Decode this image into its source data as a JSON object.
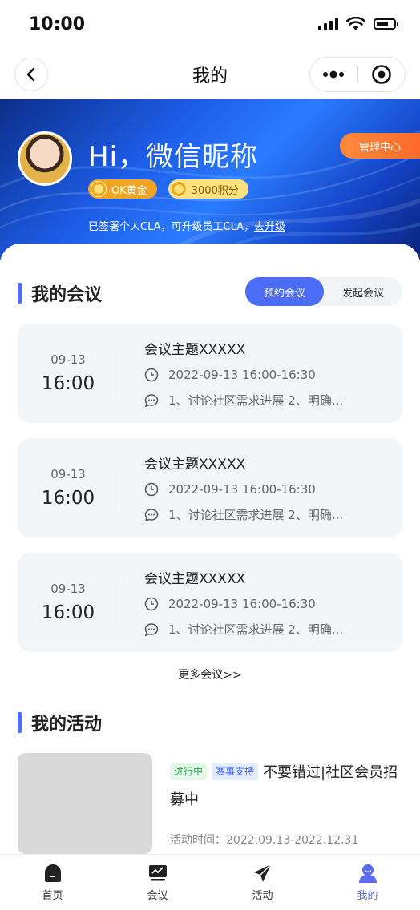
{
  "status_bar": {
    "time": "10:00"
  },
  "nav": {
    "title": "我的"
  },
  "profile": {
    "greeting": "Hi，微信昵称",
    "level_badge": "OK黄金",
    "points_badge": "3000积分",
    "cla_text": "已签署个人CLA，可升级员工CLA，",
    "cla_link": "去升级",
    "manage_button": "管理中心"
  },
  "meetings": {
    "section_title": "我的会议",
    "tabs": [
      {
        "label": "预约会议",
        "active": true
      },
      {
        "label": "发起会议",
        "active": false
      }
    ],
    "items": [
      {
        "date": "09-13",
        "time": "16:00",
        "title": "会议主题XXXXX",
        "datetime": "2022-09-13  16:00-16:30",
        "agenda": "1、讨论社区需求进展 2、明确..."
      },
      {
        "date": "09-13",
        "time": "16:00",
        "title": "会议主题XXXXX",
        "datetime": "2022-09-13  16:00-16:30",
        "agenda": "1、讨论社区需求进展 2、明确..."
      },
      {
        "date": "09-13",
        "time": "16:00",
        "title": "会议主题XXXXX",
        "datetime": "2022-09-13  16:00-16:30",
        "agenda": "1、讨论社区需求进展 2、明确..."
      }
    ],
    "more_link": "更多会议>>"
  },
  "activities": {
    "section_title": "我的活动",
    "items": [
      {
        "status_tag": "进行中",
        "type_tag": "赛事支持",
        "title": "不要错过|社区会员招募中",
        "time": "活动时间：2022.09.13-2022.12.31"
      }
    ]
  },
  "tab_bar": {
    "items": [
      {
        "label": "首页",
        "icon": "home-icon"
      },
      {
        "label": "会议",
        "icon": "meeting-icon"
      },
      {
        "label": "活动",
        "icon": "activity-icon"
      },
      {
        "label": "我的",
        "icon": "profile-icon",
        "active": true
      }
    ]
  },
  "colors": {
    "accent": "#4a6cf7",
    "orange": "#ff7a33",
    "tab_active": "#5b6cf0"
  }
}
